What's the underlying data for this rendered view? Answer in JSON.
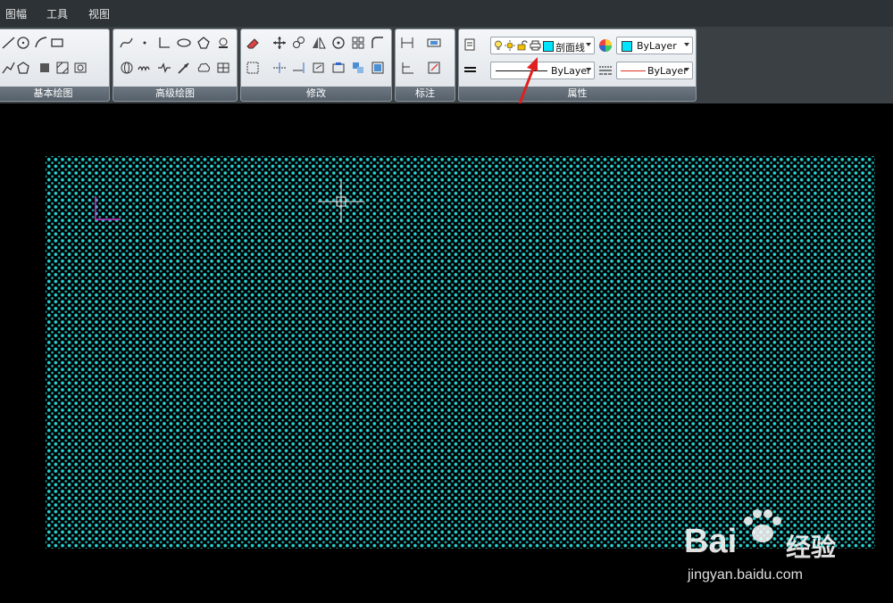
{
  "menu": {
    "items": [
      "图幅",
      "工具",
      "视图"
    ]
  },
  "ribbon": {
    "panels": [
      {
        "title": "基本绘图"
      },
      {
        "title": "高级绘图"
      },
      {
        "title": "修改"
      },
      {
        "title": "标注"
      },
      {
        "title": "属性"
      }
    ],
    "properties": {
      "layer_name": "剖面线",
      "layer_color": "#00e5ff",
      "color_dropdown": "ByLayer",
      "color_swatch": "#00e5ff",
      "linetype_dropdown": "ByLayer",
      "lineweight_dropdown": "ByLayer",
      "lineweight_color": "#e0301e"
    }
  },
  "canvas": {
    "background": "#000000",
    "hatch_color": "#29d4d4",
    "ucs_color": "#cc33cc"
  },
  "watermark": {
    "brand": "Bai",
    "brand_suffix": "经验",
    "url": "jingyan.baidu.com"
  },
  "annotation": {
    "arrow_color": "#e02020"
  }
}
